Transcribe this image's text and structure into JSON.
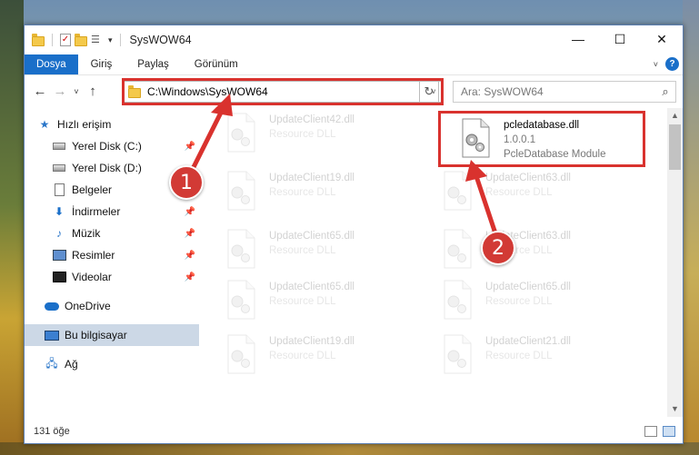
{
  "window": {
    "title": "SysWOW64",
    "minimize": "—",
    "maximize": "☐",
    "close": "✕"
  },
  "ribbon": {
    "tabs": [
      {
        "label": "Dosya",
        "active": true
      },
      {
        "label": "Giriş"
      },
      {
        "label": "Paylaş"
      },
      {
        "label": "Görünüm"
      }
    ],
    "help": "?"
  },
  "navigation": {
    "back": "←",
    "forward": "→",
    "recent": "˅",
    "up": "↑",
    "address": "C:\\Windows\\SysWOW64",
    "refresh": "↻",
    "search_placeholder": "Ara: SysWOW64"
  },
  "sidebar": {
    "items": [
      {
        "label": "Hızlı erişim",
        "icon": "star-icon"
      },
      {
        "label": "Yerel Disk (C:)",
        "icon": "disk-icon",
        "pinned": true
      },
      {
        "label": "Yerel Disk (D:)",
        "icon": "disk-icon"
      },
      {
        "label": "Belgeler",
        "icon": "documents-icon"
      },
      {
        "label": "İndirmeler",
        "icon": "downloads-icon",
        "pinned": true
      },
      {
        "label": "Müzik",
        "icon": "music-icon",
        "pinned": true
      },
      {
        "label": "Resimler",
        "icon": "pictures-icon",
        "pinned": true
      },
      {
        "label": "Videolar",
        "icon": "videos-icon",
        "pinned": true
      },
      {
        "label": "OneDrive",
        "icon": "onedrive-icon"
      },
      {
        "label": "Bu bilgisayar",
        "icon": "computer-icon",
        "selected": true
      },
      {
        "label": "Ağ",
        "icon": "network-icon"
      }
    ]
  },
  "files": {
    "highlighted": {
      "name": "pcledatabase.dll",
      "version": "1.0.0.1",
      "description": "PcleDatabase Module"
    },
    "faded": [
      {
        "name": "UpdateClient42.dll",
        "type": "Resource DLL"
      },
      {
        "name": "UpdateClient19.dll",
        "type": "Resource DLL"
      },
      {
        "name": "UpdateClient65.dll",
        "type": "Resource DLL"
      },
      {
        "name": "UpdateClient63.dll",
        "type": "Resource DLL"
      },
      {
        "name": "UpdateClient63.dll",
        "type": "Resource DLL"
      },
      {
        "name": "UpdateClient65.dll",
        "type": "Resource DLL"
      },
      {
        "name": "UpdateClient65.dll",
        "type": "Resource DLL"
      },
      {
        "name": "UpdateClient19.dll",
        "type": "Resource DLL"
      },
      {
        "name": "UpdateClient21.dll",
        "type": "Resource DLL"
      }
    ]
  },
  "status": {
    "count": "131 öğe"
  },
  "callouts": {
    "one": "1",
    "two": "2"
  },
  "colors": {
    "accent": "#1a6fc9",
    "highlight": "#d9322e"
  }
}
